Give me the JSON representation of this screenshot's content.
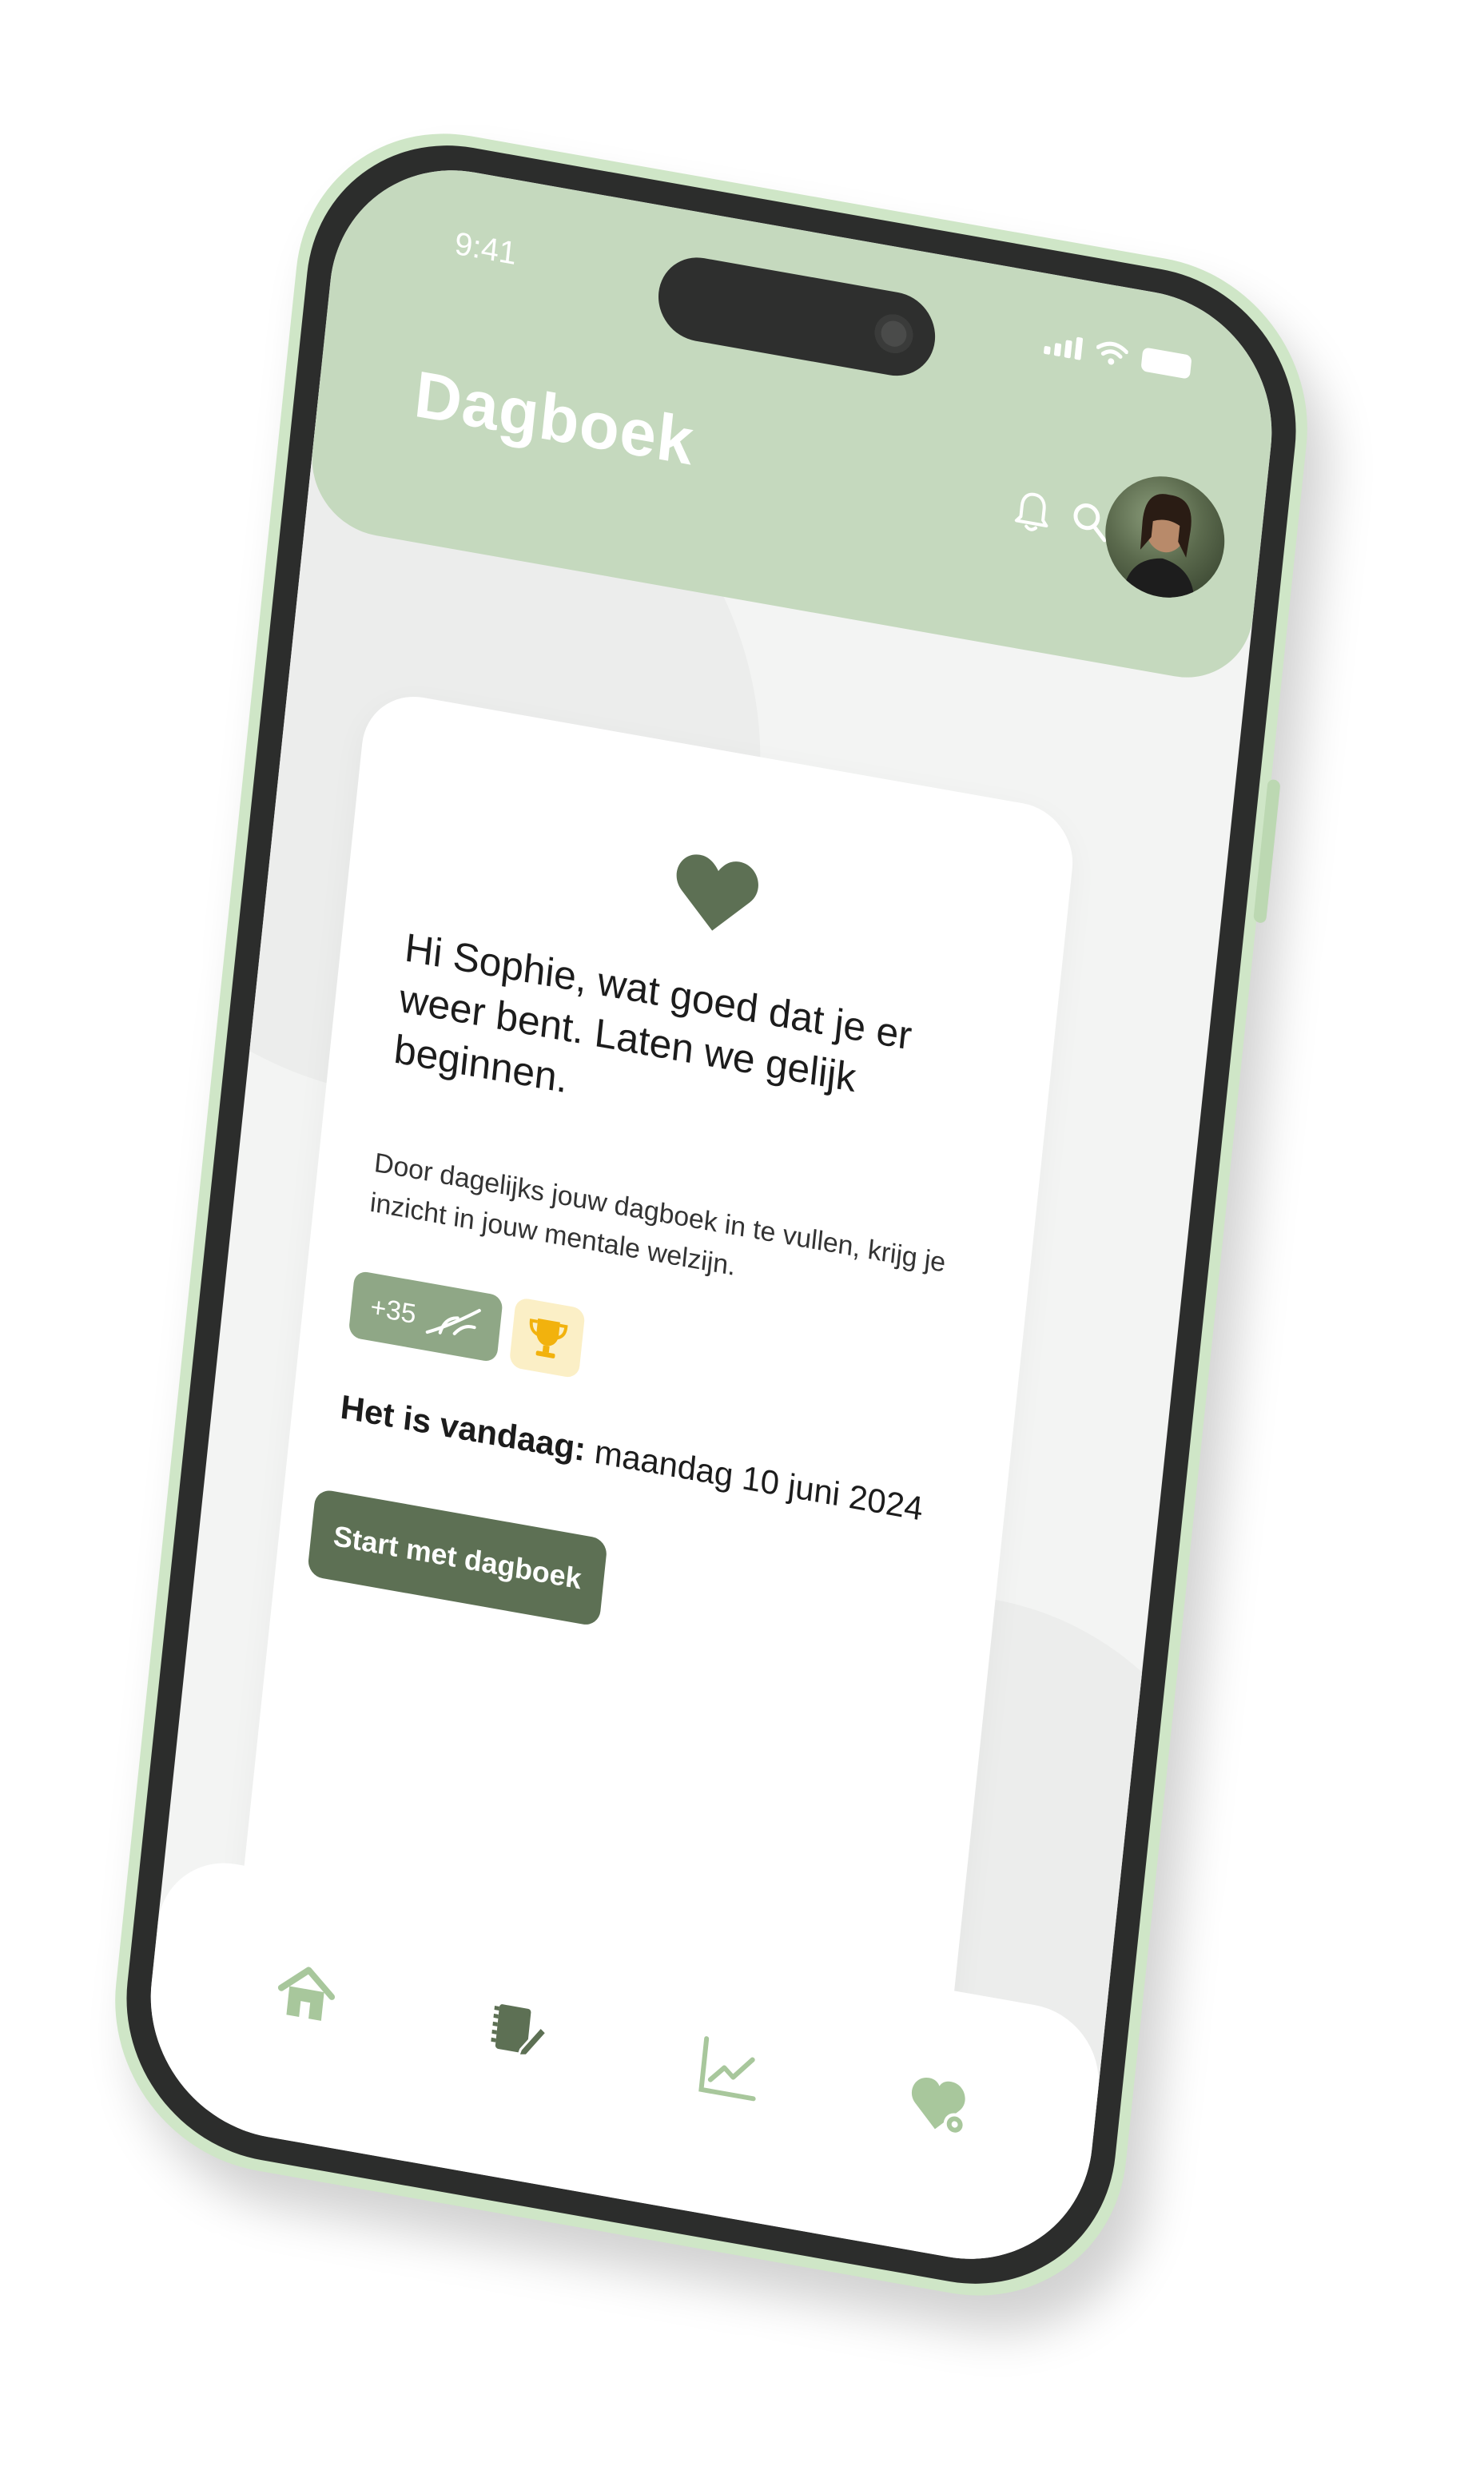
{
  "status_bar": {
    "time": "9:41"
  },
  "header": {
    "title": "Dagboek",
    "icons": [
      "bell-icon",
      "search-icon"
    ],
    "avatar": "profile-avatar"
  },
  "card": {
    "icon": "heart-icon",
    "greeting": "Hi Sophie, wat goed dat je er weer bent. Laten we gelijk beginnen.",
    "description": "Door dagelijks jouw dagboek in te vullen, krijg je inzicht in jouw mentale welzijn.",
    "points_badge": "+35",
    "trophy_icon": "trophy-icon",
    "today_label": "Het is vandaag:",
    "today_date": "maandag 10 juni 2024",
    "start_button": "Start met dagboek"
  },
  "tabbar": {
    "items": [
      "home-icon",
      "journal-icon",
      "chart-icon",
      "heart-settings-icon"
    ],
    "active": "journal-icon"
  },
  "colors": {
    "header_green": "#c5d9be",
    "accent_dark_green": "#5d7054",
    "badge_green": "#8fa786",
    "trophy_bg": "#fbefc6",
    "frame": "#cfe6c7"
  }
}
